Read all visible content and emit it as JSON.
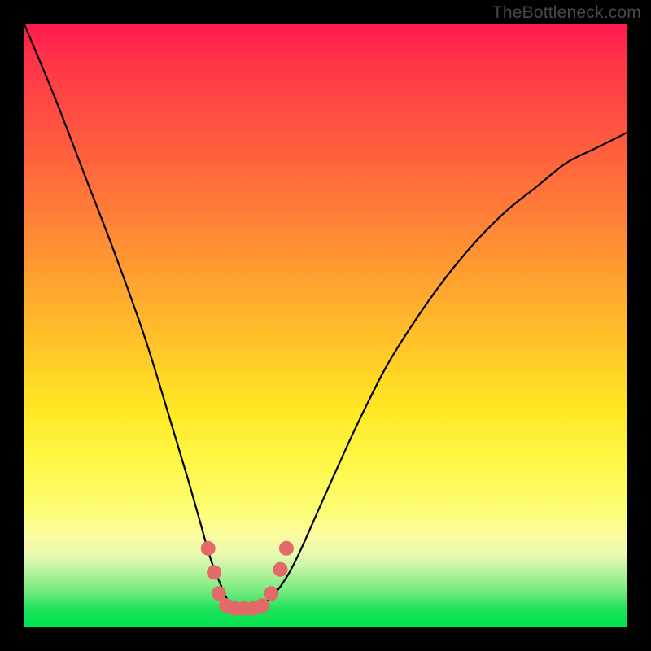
{
  "watermark": {
    "text": "TheBottleneck.com"
  },
  "chart_data": {
    "type": "line",
    "title": "",
    "xlabel": "",
    "ylabel": "",
    "xlim": [
      0,
      100
    ],
    "ylim": [
      0,
      100
    ],
    "series": [
      {
        "name": "bottleneck-curve",
        "x": [
          0,
          5,
          10,
          15,
          20,
          24,
          27,
          29,
          31,
          33,
          34,
          35,
          36,
          38,
          40,
          42,
          44,
          46,
          50,
          55,
          60,
          65,
          70,
          75,
          80,
          85,
          90,
          95,
          100
        ],
        "y": [
          100,
          88,
          75,
          62,
          48,
          35,
          25,
          18,
          11,
          6,
          4,
          3,
          3,
          3,
          4,
          6,
          9,
          13,
          22,
          33,
          43,
          51,
          58,
          64,
          69,
          73,
          77,
          79.5,
          82
        ]
      }
    ],
    "markers": {
      "name": "highlight-dots",
      "color": "#e46a6a",
      "points": [
        {
          "x": 30.5,
          "y": 13
        },
        {
          "x": 31.5,
          "y": 9
        },
        {
          "x": 32.3,
          "y": 5.5
        },
        {
          "x": 33.5,
          "y": 3.5
        },
        {
          "x": 35.0,
          "y": 3
        },
        {
          "x": 36.5,
          "y": 3
        },
        {
          "x": 38.0,
          "y": 3
        },
        {
          "x": 39.5,
          "y": 3.5
        },
        {
          "x": 41.0,
          "y": 5.5
        },
        {
          "x": 42.5,
          "y": 9.5
        },
        {
          "x": 43.5,
          "y": 13
        }
      ]
    },
    "gradient_stops": [
      {
        "pos": 0,
        "color": "#ff1a4f"
      },
      {
        "pos": 50,
        "color": "#ffc728"
      },
      {
        "pos": 80,
        "color": "#fdfd70"
      },
      {
        "pos": 100,
        "color": "#00e24f"
      }
    ]
  }
}
